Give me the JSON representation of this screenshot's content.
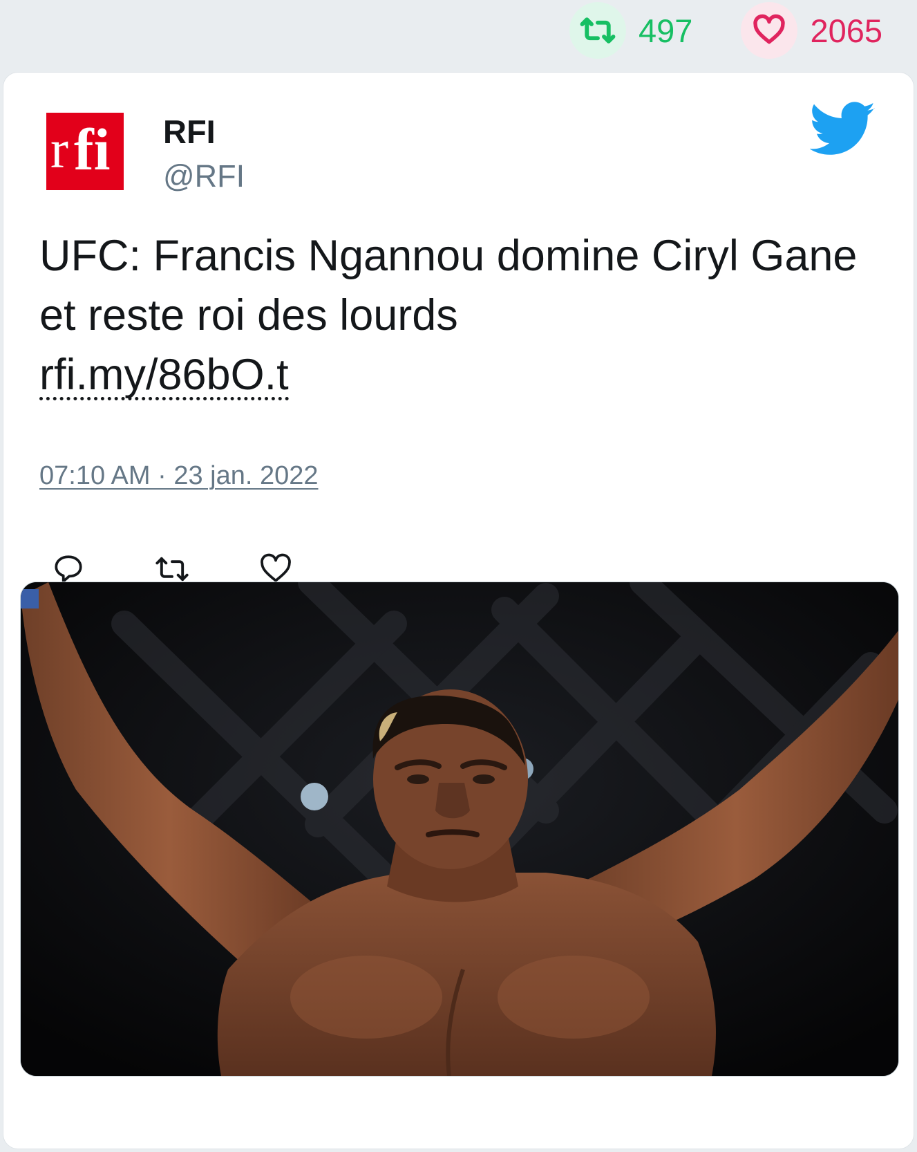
{
  "stats": {
    "retweets": "497",
    "likes": "2065",
    "retweet_color": "#17bf63",
    "like_color": "#e0245e"
  },
  "tweet": {
    "author_name": "RFI",
    "author_handle": "@RFI",
    "avatar_logo": {
      "part1": "r",
      "part2": "fi"
    },
    "text": "UFC: Francis Ngannou domine Ciryl Gane et reste roi des lourds",
    "link": "rfi.my/86bO.t",
    "timestamp": "07:10 AM · 23 jan. 2022"
  },
  "icons": {
    "stats": [
      "retweet-icon",
      "heart-icon"
    ],
    "header": "twitter-bird-icon",
    "actions": [
      "reply-icon",
      "retweet-icon",
      "like-icon"
    ]
  },
  "colors": {
    "page_background": "#e9edf0",
    "twitter_blue": "#1da1f2",
    "rfi_red": "#e2001a"
  }
}
